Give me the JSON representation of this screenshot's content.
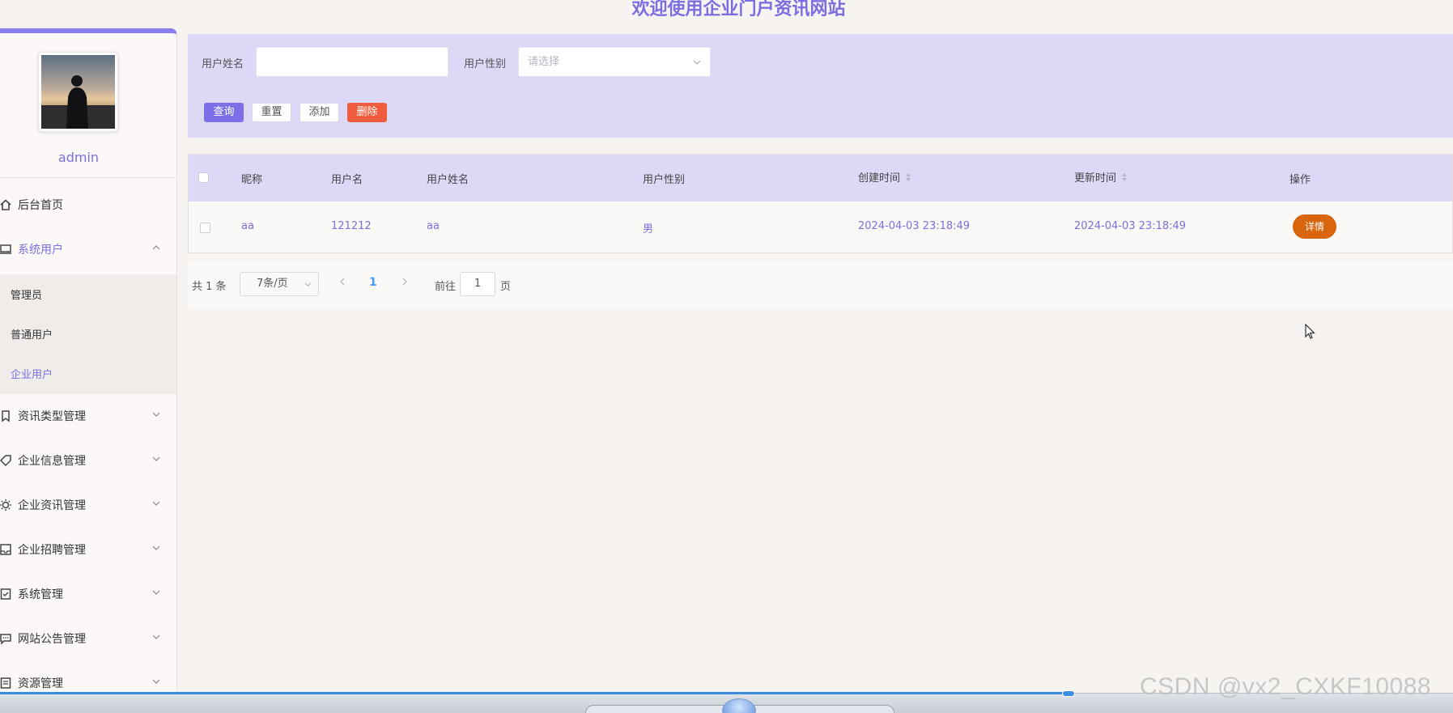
{
  "header": {
    "title": "欢迎使用企业门户资讯网站"
  },
  "sidebar": {
    "username": "admin",
    "menu": [
      {
        "label": "后台首页",
        "icon": "home-icon"
      },
      {
        "label": "系统用户",
        "icon": "monitor-icon",
        "expanded": true
      },
      {
        "label": "资讯类型管理",
        "icon": "bookmark-icon"
      },
      {
        "label": "企业信息管理",
        "icon": "tag-icon"
      },
      {
        "label": "企业资讯管理",
        "icon": "sun-icon"
      },
      {
        "label": "企业招聘管理",
        "icon": "inbox-icon"
      },
      {
        "label": "系统管理",
        "icon": "checklist-icon"
      },
      {
        "label": "网站公告管理",
        "icon": "message-icon"
      },
      {
        "label": "资源管理",
        "icon": "document-icon"
      }
    ],
    "submenu": [
      {
        "label": "管理员"
      },
      {
        "label": "普通用户"
      },
      {
        "label": "企业用户",
        "active": true
      }
    ]
  },
  "search": {
    "name_label": "用户姓名",
    "name_value": "",
    "gender_label": "用户性别",
    "gender_placeholder": "请选择",
    "buttons": {
      "query": "查询",
      "reset": "重置",
      "add": "添加",
      "delete": "删除"
    }
  },
  "table": {
    "columns": [
      "昵称",
      "用户名",
      "用户姓名",
      "用户性别",
      "创建时间",
      "更新时间",
      "操作"
    ],
    "rows": [
      {
        "nickname": "aa",
        "username": "121212",
        "realname": "aa",
        "gender": "男",
        "created": "2024-04-03 23:18:49",
        "updated": "2024-04-03 23:18:49",
        "action": "详情"
      }
    ]
  },
  "pagination": {
    "total": "共 1 条",
    "page_size": "7条/页",
    "current_page": "1",
    "goto_prefix": "前往",
    "goto_value": "1",
    "goto_suffix": "页"
  },
  "watermark": "CSDN @vx2_CXKF10088",
  "colors": {
    "accent": "#7b6ee0",
    "panel": "#dcd8f6",
    "danger": "#f05c3e",
    "detail": "#d8650b"
  }
}
